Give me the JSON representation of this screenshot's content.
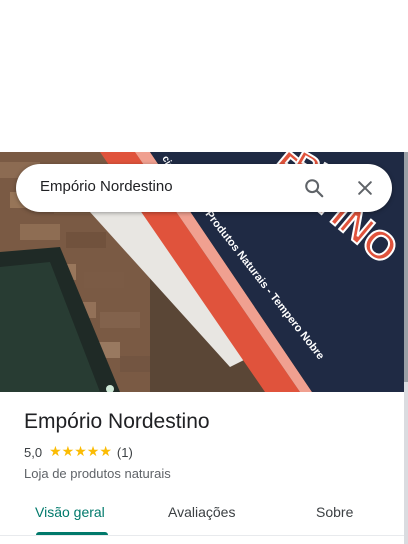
{
  "search": {
    "query": "Empório Nordestino"
  },
  "photo": {
    "sign_text_line1": "Produtos Naturais - Tempero Nobre",
    "sign_brand_top": "RIO",
    "sign_brand_bottom": "ESTINO",
    "sign_edge_text": "cia"
  },
  "place": {
    "name": "Empório Nordestino",
    "rating": "5,0",
    "stars": 5,
    "review_count": "(1)",
    "category": "Loja de produtos naturais"
  },
  "tabs": [
    {
      "label": "Visão geral",
      "active": true
    },
    {
      "label": "Avaliações",
      "active": false
    },
    {
      "label": "Sobre",
      "active": false
    }
  ],
  "colors": {
    "accent": "#00796b",
    "star": "#fbbc04",
    "sign_blue": "#1f2a44",
    "sign_red": "#e0533c"
  }
}
